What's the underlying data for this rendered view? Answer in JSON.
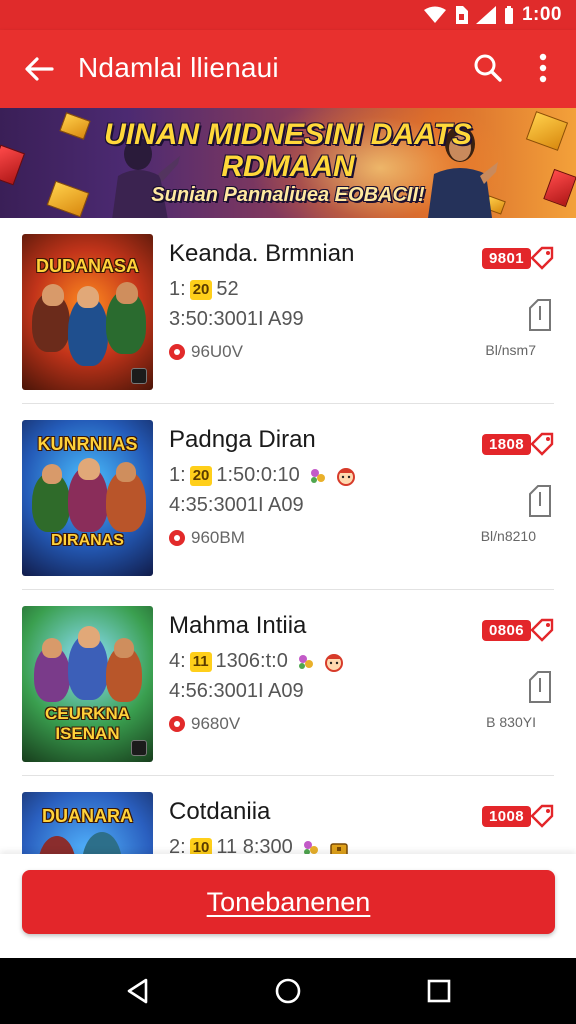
{
  "status_bar": {
    "time": "1:00"
  },
  "app_bar": {
    "title": "Ndamlai llienaui"
  },
  "banner": {
    "line1": "UINAN MIDNESINI DAATS",
    "line2": "RDMAAN",
    "line3": "Sunian Pannaliuea EOBACII!"
  },
  "items": [
    {
      "thumb_title": "DUDANASA",
      "name": "Keanda. Brmnian",
      "meta1_prefix": "1:",
      "meta1_badge": "20",
      "meta1_text": "52",
      "meta2": "3:50:3001I A99",
      "meta3": "96U0V",
      "price": "9801",
      "size": "Bl/nsm7"
    },
    {
      "thumb_title": "KUNRNIIAS",
      "thumb_sub": "DIRANAS",
      "name": "Padnga Diran",
      "meta1_prefix": "1:",
      "meta1_badge": "20",
      "meta1_text": "1:50:0:10",
      "meta2": "4:35:3001I A09",
      "meta3": "960BM",
      "price": "1808",
      "size": "Bl/n8210"
    },
    {
      "thumb_title": "CEURKNA",
      "thumb_sub": "ISENAN",
      "name": "Mahma Intiia",
      "meta1_prefix": "4:",
      "meta1_badge": "11",
      "meta1_text": "1306:t:0",
      "meta2": "4:56:3001I A09",
      "meta3": "9680V",
      "price": "0806",
      "size": "B 830YI"
    },
    {
      "thumb_title": "DUANARA",
      "name": "Cotdaniia",
      "meta1_prefix": "2:",
      "meta1_badge": "10",
      "meta1_text": "11 8:300",
      "price": "1008"
    }
  ],
  "primary_button": {
    "label": "Tonebanenen"
  },
  "colors": {
    "brand_red": "#e3262a",
    "badge_yellow": "#ffcf1a"
  },
  "icons": [
    "wifi-icon",
    "sim-icon",
    "signal-icon",
    "back-arrow-icon",
    "search-icon",
    "more-vert-icon",
    "tag-icon",
    "download-file-icon",
    "nav-back-icon",
    "nav-home-icon",
    "nav-recents-icon"
  ]
}
